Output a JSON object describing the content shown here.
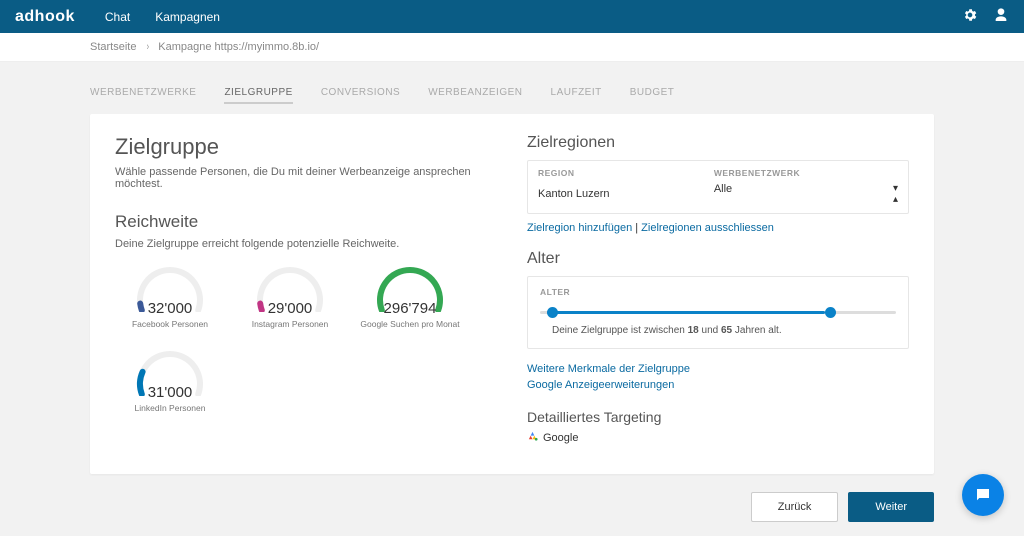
{
  "brand": "adhook",
  "nav": {
    "chat": "Chat",
    "kamp": "Kampagnen"
  },
  "breadcrumb": {
    "home": "Startseite",
    "current": "Kampagne https://myimmo.8b.io/"
  },
  "tabs": {
    "werbenetzwerke": "WERBENETZWERKE",
    "zielgruppe": "ZIELGRUPPE",
    "conversions": "CONVERSIONS",
    "werbeanzeigen": "WERBEANZEIGEN",
    "laufzeit": "LAUFZEIT",
    "budget": "BUDGET"
  },
  "left": {
    "title": "Zielgruppe",
    "sub": "Wähle passende Personen, die Du mit deiner Werbeanzeige ansprechen möchtest.",
    "reach_title": "Reichweite",
    "reach_sub": "Deine Zielgruppe erreicht folgende potenzielle Reichweite.",
    "gauges": [
      {
        "value": "32'000",
        "label": "Facebook Personen",
        "color": "#3b5998",
        "fill": 6
      },
      {
        "value": "29'000",
        "label": "Instagram Personen",
        "color": "#c13584",
        "fill": 6
      },
      {
        "value": "296'794",
        "label": "Google Suchen pro Monat",
        "color": "#34a853",
        "fill": 100
      },
      {
        "value": "31'000",
        "label": "LinkedIn Personen",
        "color": "#0077b5",
        "fill": 20
      }
    ]
  },
  "right": {
    "regions_title": "Zielregionen",
    "regions_header": {
      "region": "REGION",
      "net": "WERBENETZWERK"
    },
    "regions_row": {
      "region": "Kanton Luzern",
      "net": "Alle"
    },
    "region_links": {
      "add": "Zielregion hinzufügen",
      "sep": " | ",
      "exclude": "Zielregionen ausschliessen"
    },
    "alter_title": "Alter",
    "alter_label": "ALTER",
    "alter_msg_pre": "Deine Zielgruppe ist zwischen ",
    "alter_min": "18",
    "alter_mid": " und ",
    "alter_max": "65",
    "alter_msg_post": " Jahren alt.",
    "more1": "Weitere Merkmale der Zielgruppe",
    "more2": "Google Anzeigeerweiterungen",
    "det_title": "Detailliertes Targeting",
    "det_google": "Google"
  },
  "buttons": {
    "back": "Zurück",
    "next": "Weiter"
  }
}
